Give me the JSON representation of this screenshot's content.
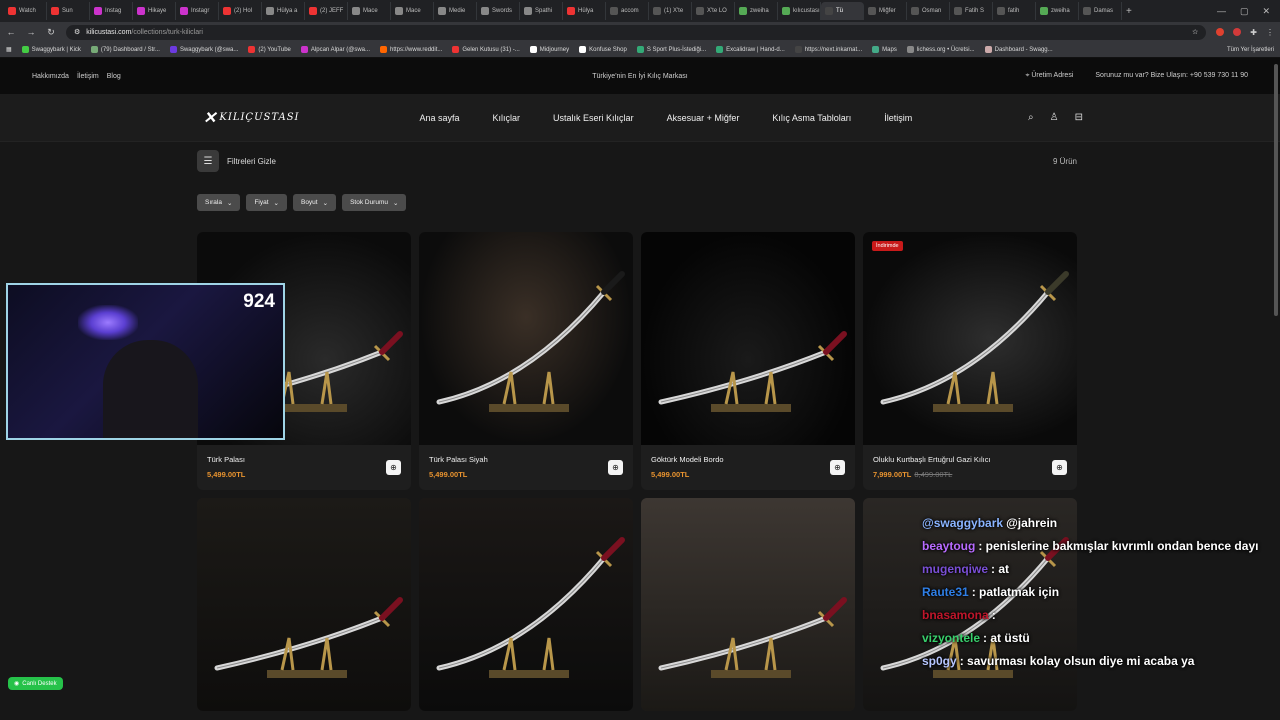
{
  "browser": {
    "tabs": [
      "Watch",
      "Sun",
      "Instag",
      "Hikaye",
      "Instagr",
      "(2) Hol",
      "Hülya a",
      "(2) JEFF",
      "Mace",
      "Mace",
      "Medie",
      "Swords",
      "Spathi",
      "Hülya",
      "accom",
      "(1) X'te",
      "X'te LO",
      "zweiha",
      "kılıcustası",
      "Tü",
      "Miğfer",
      "Osman",
      "Fatih S",
      "fatih",
      "zweiha",
      "Damas"
    ],
    "url_domain": "kilicustasi.com",
    "url_path": "/collections/turk-kiliclari",
    "bookmarks": [
      "Swaggybark | Kick",
      "(79) Dashboard / Str...",
      "Swaggybark (@swa...",
      "(2) YouTube",
      "Alpcan Alpar (@swa...",
      "https://www.reddit...",
      "Gelen Kutusu (31) -...",
      "Midjourney",
      "Konfuse Shop",
      "S Sport Plus-İstediği...",
      "Excalidraw | Hand-d...",
      "https://next.inkarnat...",
      "Maps",
      "lichess.org • Ücretsi...",
      "Dashboard - Swagg..."
    ],
    "bookmarks_right": "Tüm Yer İşaretleri"
  },
  "topbar": {
    "left_links": [
      "Hakkımızda",
      "İletişim",
      "Blog"
    ],
    "center": "Türkiye'nin En İyi Kılıç Markası",
    "address": "Üretim Adresi",
    "contact": "Sorunuz mu var? Bize Ulaşın: +90 539 730 11 90"
  },
  "header": {
    "logo": "KILIÇUSTASI",
    "menu": [
      "Ana sayfa",
      "Kılıçlar",
      "Ustalık Eseri Kılıçlar",
      "Aksesuar + Miğfer",
      "Kılıç Asma Tabloları",
      "İletişim"
    ]
  },
  "filters": {
    "toggle_label": "Filtreleri Gizle",
    "count": "9 Ürün",
    "chips": [
      "Sırala",
      "Fiyat",
      "Boyut",
      "Stok Durumu"
    ]
  },
  "products": [
    {
      "name": "Türk Palası",
      "price": "5,499.00TL",
      "old": "",
      "badge": ""
    },
    {
      "name": "Türk Palası Siyah",
      "price": "5,499.00TL",
      "old": "",
      "badge": ""
    },
    {
      "name": "Göktürk Modeli Bordo",
      "price": "5,499.00TL",
      "old": "",
      "badge": ""
    },
    {
      "name": "Oluklu Kurtbaşlı Ertuğrul Gazi Kılıcı",
      "price": "7,999.00TL",
      "old": "8,499.00TL",
      "badge": "İndirimde"
    },
    {
      "name": "",
      "price": "",
      "old": "",
      "badge": ""
    },
    {
      "name": "",
      "price": "",
      "old": "",
      "badge": ""
    },
    {
      "name": "",
      "price": "",
      "old": "",
      "badge": ""
    },
    {
      "name": "",
      "price": "",
      "old": "",
      "badge": ""
    }
  ],
  "stream": {
    "viewers": "924",
    "support_label": "Canlı Destek",
    "chat": [
      {
        "user": "@swaggybark",
        "msg": "@jahrein",
        "color": "#8ab4ff"
      },
      {
        "user": "beaytoug",
        "msg": ": penislerine bakmışlar kıvrımlı ondan bence dayı",
        "color": "#b86bff"
      },
      {
        "user": "mugenqiwe",
        "msg": ": at",
        "color": "#7a4fd6"
      },
      {
        "user": "Raute31",
        "msg": ": patlatmak için",
        "color": "#2f7fe6"
      },
      {
        "user": "bnasamona",
        "msg": ":",
        "color": "#c0162b"
      },
      {
        "user": "vizyontele",
        "msg": ": at üstü",
        "color": "#38d06c"
      },
      {
        "user": "sp0gy",
        "msg": ": savurması kolay olsun diye mi acaba ya",
        "color": "#b7c6ff"
      }
    ]
  }
}
